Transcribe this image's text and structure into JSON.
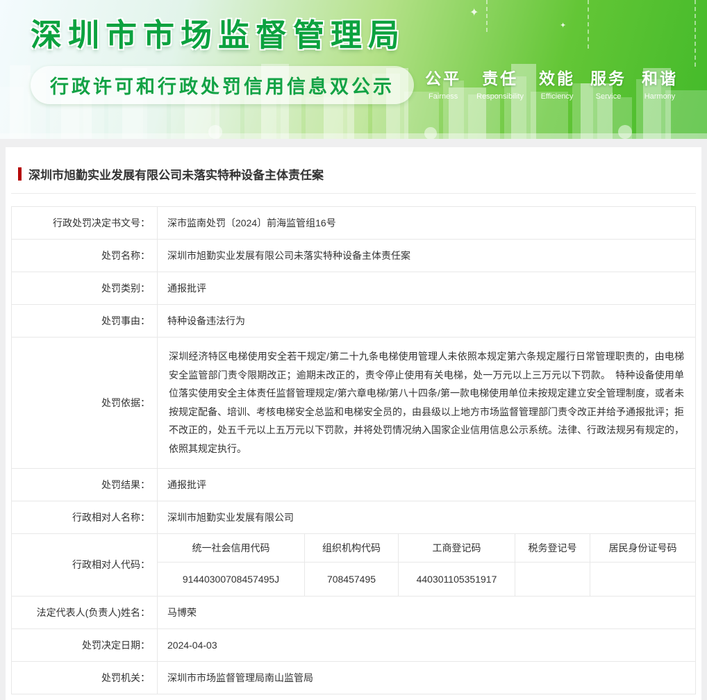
{
  "header": {
    "site_title": "深圳市市场监督管理局",
    "site_subtitle": "行政许可和行政处罚信用信息双公示",
    "slogan": [
      {
        "cn": "公平",
        "en": "Fairness"
      },
      {
        "cn": "责任",
        "en": "Responsibility"
      },
      {
        "cn": "效能",
        "en": "Efficiency"
      },
      {
        "cn": "服务",
        "en": "Service"
      },
      {
        "cn": "和谐",
        "en": "Harmony"
      }
    ],
    "colors": {
      "title_green": "#0ca23f",
      "banner_green": "#43ba2a",
      "accent_red": "#b50505"
    }
  },
  "article": {
    "title": "深圳市旭勤实业发展有限公司未落实特种设备主体责任案"
  },
  "table": {
    "rows_top": [
      {
        "label": "行政处罚决定书文号：",
        "value": "深市监南处罚〔2024〕前海监管组16号"
      },
      {
        "label": "处罚名称：",
        "value": "深圳市旭勤实业发展有限公司未落实特种设备主体责任案"
      },
      {
        "label": "处罚类别：",
        "value": "通报批评"
      },
      {
        "label": "处罚事由：",
        "value": "特种设备违法行为"
      },
      {
        "label": "处罚依据：",
        "value": "深圳经济特区电梯使用安全若干规定/第二十九条电梯使用管理人未依照本规定第六条规定履行日常管理职责的，由电梯安全监管部门责令限期改正；逾期未改正的，责令停止使用有关电梯，处一万元以上三万元以下罚款。　特种设备使用单位落实使用安全主体责任监督管理规定/第六章电梯/第八十四条/第一款电梯使用单位未按规定建立安全管理制度，或者未按规定配备、培训、考核电梯安全总监和电梯安全员的，由县级以上地方市场监督管理部门责令改正并给予通报批评；拒不改正的，处五千元以上五万元以下罚款，并将处罚情况纳入国家企业信用信息公示系统。法律、行政法规另有规定的，依照其规定执行。"
      },
      {
        "label": "处罚结果：",
        "value": "通报批评"
      },
      {
        "label": "行政相对人名称：",
        "value": "深圳市旭勤实业发展有限公司"
      }
    ],
    "code_row": {
      "label": "行政相对人代码：",
      "columns": [
        "统一社会信用代码",
        "组织机构代码",
        "工商登记码",
        "税务登记号",
        "居民身份证号码"
      ],
      "values": [
        "91440300708457495J",
        "708457495",
        "440301105351917",
        "",
        ""
      ]
    },
    "rows_bottom": [
      {
        "label": "法定代表人(负责人)姓名：",
        "value": "马博荣"
      },
      {
        "label": "处罚决定日期：",
        "value": "2024-04-03"
      },
      {
        "label": "处罚机关：",
        "value": "深圳市市场监督管理局南山监管局"
      }
    ]
  }
}
